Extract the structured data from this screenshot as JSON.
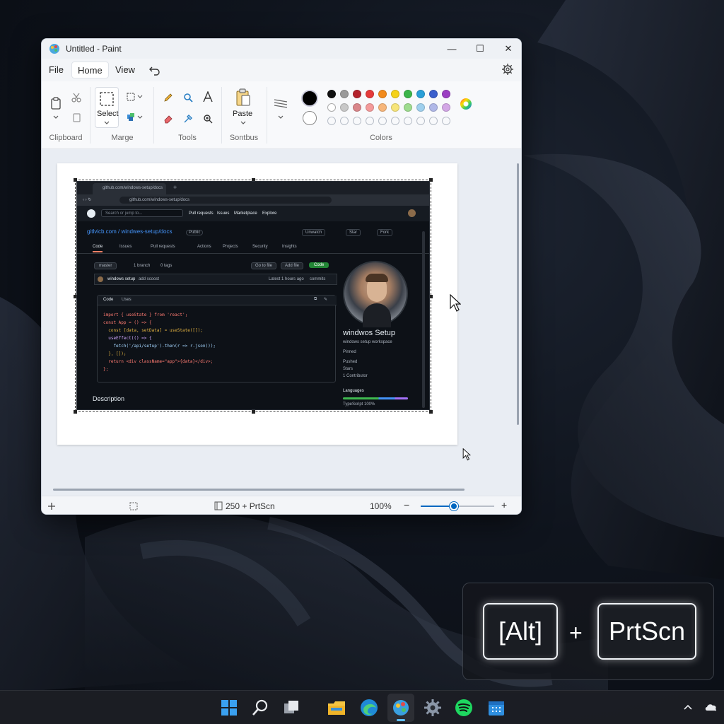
{
  "window": {
    "title": "Untitled - Paint",
    "minimize": "—",
    "maximize": "☐",
    "close": "✕"
  },
  "menu": {
    "file": "File",
    "home": "Home",
    "view": "View"
  },
  "ribbon": {
    "clipboard": "Clipboard",
    "image": "Marge",
    "tools": "Tools",
    "shapes": "Sontbus",
    "colors": "Colors",
    "select_label": "Select",
    "paste_label": "Paste",
    "palette_row1": [
      "#111111",
      "#9a9a9a",
      "#b3222c",
      "#e53a3a",
      "#f28a1c",
      "#f5d21a",
      "#3bb54a",
      "#2a9fd8",
      "#3a5fcd",
      "#9b3fc2"
    ],
    "palette_row2": [
      "#ffffff",
      "#c8c8c8",
      "#d9868a",
      "#f49a9a",
      "#f7b67a",
      "#f7e57a",
      "#9edc8f",
      "#9fd0ee",
      "#b0b8e8",
      "#d3a7e6"
    ]
  },
  "status": {
    "selection": "250 + PrtScn",
    "zoom": "100%",
    "zoom_level": 0.45
  },
  "screenshot": {
    "tab_title": "github.com/windows-setup/docs",
    "address": "github.com/windows-setup/docs",
    "search_placeholder": "Search or jump to...",
    "nav": [
      "Pull requests",
      "Issues",
      "Marketplace",
      "Explore"
    ],
    "repo_path": "gitlvicb.com / windwes-setup/docs",
    "repo_badge": "Public",
    "repo_buttons": [
      "Unwatch",
      "Star",
      "Fork"
    ],
    "tabs": [
      "Code",
      "Issues",
      "Pull requests",
      "Actions",
      "Projects",
      "Security",
      "Insights"
    ],
    "branch": "master",
    "branch_count": "1 branch",
    "tags": "0 tags",
    "go_to_file": "Go to file",
    "add_file": "Add file",
    "code_btn": "Code",
    "commit_user": "windows setup",
    "commit_msg": "add scoost",
    "commit_time": "Latest 1 hours ago",
    "commit_count": "commits",
    "code_tabs": [
      "Code",
      "Uses"
    ],
    "code_lines": [
      "import { useState } from 'react';",
      "const App = () => {",
      "  const [data, setData] = useState([]);",
      "  useEffect(() => {",
      "    fetch('/api/setup').then(r => r.json());",
      "  }, []);",
      "  return <div className=\"app\">{data}</div>;",
      "};"
    ],
    "description": "Description",
    "profile_name": "windwos Setup",
    "profile_sub": "windows setup workspace",
    "profile_items": [
      "Pinned",
      "Pushed",
      "Stars",
      "1 Contributor"
    ],
    "languages": "Languages",
    "language_detail": "TypeScript 100%"
  },
  "keys": {
    "alt": "[Alt]",
    "plus": "+",
    "prtscn": "PrtScn"
  },
  "colors": {
    "accent": "#0067c0",
    "github_green": "#238636"
  }
}
